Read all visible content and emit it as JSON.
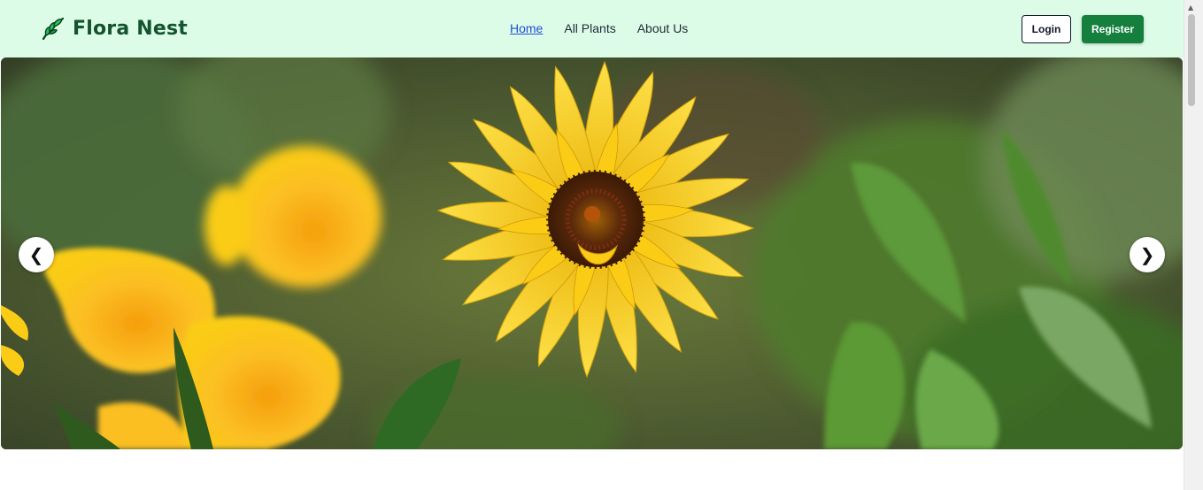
{
  "brand": {
    "name": "Flora Nest",
    "icon": "leaf-icon",
    "color": "#14532d"
  },
  "nav": {
    "items": [
      {
        "label": "Home",
        "active": true
      },
      {
        "label": "All Plants",
        "active": false
      },
      {
        "label": "About Us",
        "active": false
      }
    ]
  },
  "auth": {
    "login_label": "Login",
    "register_label": "Register"
  },
  "hero": {
    "prev_label": "❮",
    "next_label": "❯"
  },
  "colors": {
    "header_bg": "#dcfce8",
    "accent": "#15803d",
    "link_active": "#1d4ed8"
  }
}
